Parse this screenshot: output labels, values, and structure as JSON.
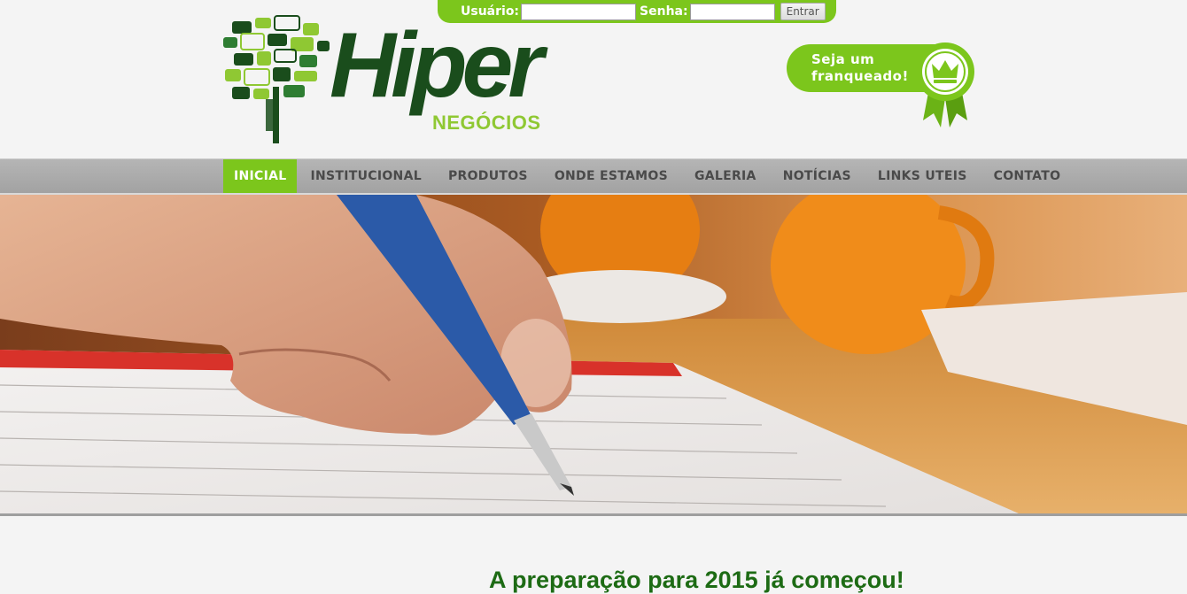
{
  "login": {
    "user_label": "Usuário:",
    "user_value": "",
    "password_label": "Senha:",
    "password_value": "",
    "submit_label": "Entrar"
  },
  "logo": {
    "word": "Hiper",
    "subword": "NEGÓCIOS"
  },
  "franchise": {
    "line1": "Seja um",
    "line2": "franqueado!"
  },
  "nav": {
    "items": [
      {
        "label": "INICIAL",
        "active": true
      },
      {
        "label": "INSTITUCIONAL"
      },
      {
        "label": "PRODUTOS"
      },
      {
        "label": "ONDE ESTAMOS"
      },
      {
        "label": "GALERIA"
      },
      {
        "label": "NOTÍCIAS"
      },
      {
        "label": "LINKS UTEIS"
      },
      {
        "label": "CONTATO"
      }
    ]
  },
  "hero": {
    "image": "photo of a hand writing with a blue pen in an agenda, orange cups in background"
  },
  "content": {
    "headline": "A preparação para 2015 já começou!"
  },
  "colors": {
    "brand_green": "#7cc61c",
    "dark_green": "#1a4d1c",
    "headline_green": "#1d6b14",
    "nav_gray": "#a8a8a8"
  }
}
